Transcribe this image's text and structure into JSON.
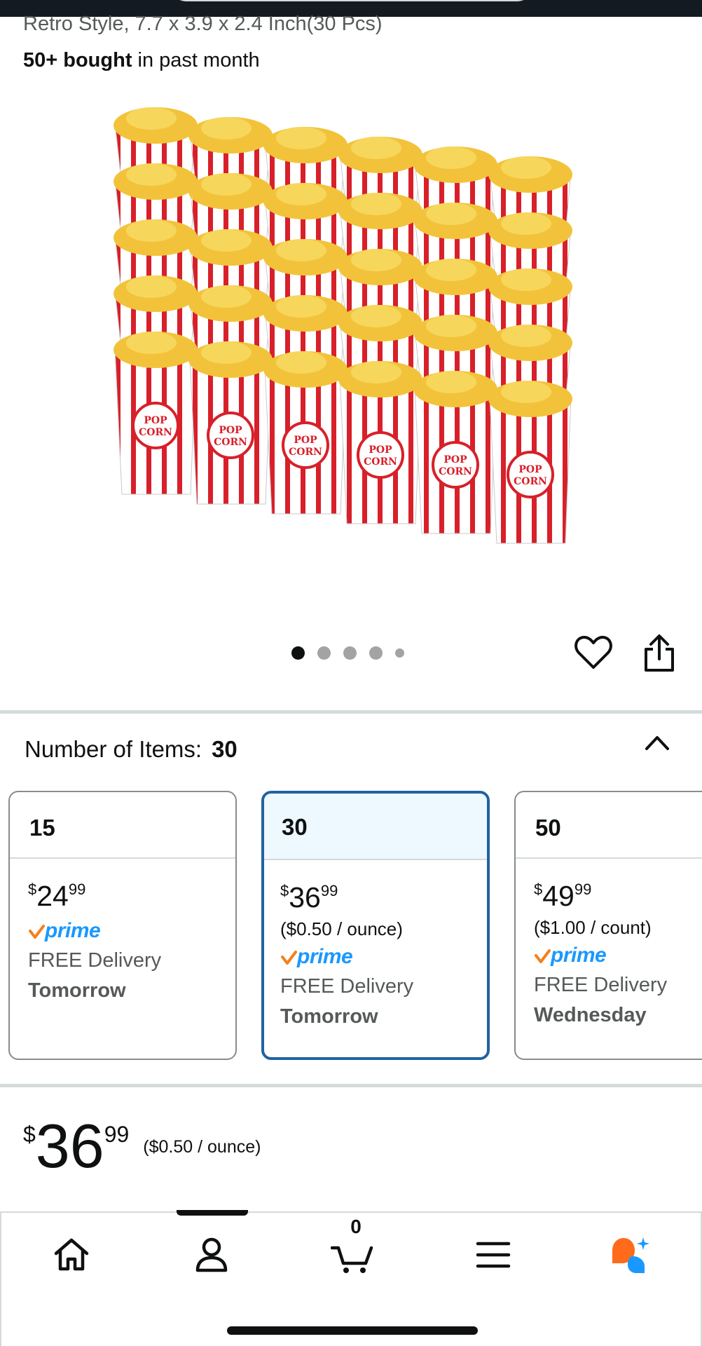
{
  "product": {
    "subtitle": "Retro Style, 7.7 x 3.9 x 2.4 Inch(30 Pcs)",
    "bought_strong": "50+ bought",
    "bought_rest": " in past month",
    "image_label": "POP CORN"
  },
  "carousel": {
    "page_count": 5,
    "active_index": 0
  },
  "items_selector": {
    "label": "Number of Items:",
    "value": "30",
    "options": [
      {
        "count": "15",
        "symbol": "$",
        "whole": "24",
        "fraction": "99",
        "unit_price": "",
        "prime": "prime",
        "delivery": "FREE Delivery",
        "when": "Tomorrow"
      },
      {
        "count": "30",
        "symbol": "$",
        "whole": "36",
        "fraction": "99",
        "unit_price": "($0.50 / ounce)",
        "prime": "prime",
        "delivery": "FREE Delivery",
        "when": "Tomorrow"
      },
      {
        "count": "50",
        "symbol": "$",
        "whole": "49",
        "fraction": "99",
        "unit_price": "($1.00 / count)",
        "prime": "prime",
        "delivery": "FREE Delivery",
        "when": "Wednesday"
      }
    ]
  },
  "price": {
    "symbol": "$",
    "whole": "36",
    "fraction": "99",
    "per_unit": "($0.50 / ounce)"
  },
  "bottom_nav": {
    "items": [
      "home-icon",
      "account-icon",
      "cart-icon",
      "menu-icon",
      "rufus-ai-icon"
    ],
    "cart_count": "0"
  },
  "colors": {
    "selected_border": "#2162a1",
    "selected_head": "#edf8ff",
    "prime_blue": "#1a98ff",
    "prime_check": "#f3801e",
    "ai_orange": "#ff6b1a",
    "ai_blue": "#1a98ff"
  }
}
